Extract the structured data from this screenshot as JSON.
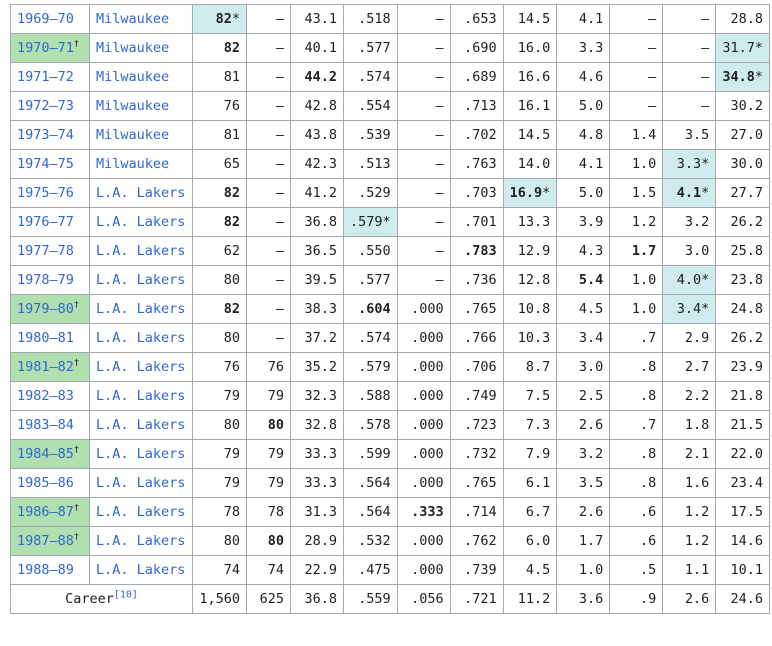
{
  "rows": [
    {
      "year": "1969–70",
      "champ": false,
      "team": "Milwaukee",
      "gp": {
        "v": "82",
        "mark": "*",
        "bold": true,
        "lead": true
      },
      "gs": {
        "v": "–"
      },
      "mpg": {
        "v": "43.1"
      },
      "fg": {
        "v": ".518"
      },
      "tp": {
        "v": "–"
      },
      "ft": {
        "v": ".653"
      },
      "rpg": {
        "v": "14.5"
      },
      "apg": {
        "v": "4.1"
      },
      "spg": {
        "v": "–"
      },
      "bpg": {
        "v": "–"
      },
      "ppg": {
        "v": "28.8"
      }
    },
    {
      "year": "1970–71",
      "champ": true,
      "team": "Milwaukee",
      "gp": {
        "v": "82",
        "bold": true
      },
      "gs": {
        "v": "–"
      },
      "mpg": {
        "v": "40.1"
      },
      "fg": {
        "v": ".577"
      },
      "tp": {
        "v": "–"
      },
      "ft": {
        "v": ".690"
      },
      "rpg": {
        "v": "16.0"
      },
      "apg": {
        "v": "3.3"
      },
      "spg": {
        "v": "–"
      },
      "bpg": {
        "v": "–"
      },
      "ppg": {
        "v": "31.7",
        "mark": "*",
        "lead": true
      }
    },
    {
      "year": "1971–72",
      "champ": false,
      "team": "Milwaukee",
      "gp": {
        "v": "81"
      },
      "gs": {
        "v": "–"
      },
      "mpg": {
        "v": "44.2",
        "bold": true
      },
      "fg": {
        "v": ".574"
      },
      "tp": {
        "v": "–"
      },
      "ft": {
        "v": ".689"
      },
      "rpg": {
        "v": "16.6"
      },
      "apg": {
        "v": "4.6"
      },
      "spg": {
        "v": "–"
      },
      "bpg": {
        "v": "–"
      },
      "ppg": {
        "v": "34.8",
        "mark": "*",
        "bold": true,
        "lead": true
      }
    },
    {
      "year": "1972–73",
      "champ": false,
      "team": "Milwaukee",
      "gp": {
        "v": "76"
      },
      "gs": {
        "v": "–"
      },
      "mpg": {
        "v": "42.8"
      },
      "fg": {
        "v": ".554"
      },
      "tp": {
        "v": "–"
      },
      "ft": {
        "v": ".713"
      },
      "rpg": {
        "v": "16.1"
      },
      "apg": {
        "v": "5.0"
      },
      "spg": {
        "v": "–"
      },
      "bpg": {
        "v": "–"
      },
      "ppg": {
        "v": "30.2"
      }
    },
    {
      "year": "1973–74",
      "champ": false,
      "team": "Milwaukee",
      "gp": {
        "v": "81"
      },
      "gs": {
        "v": "–"
      },
      "mpg": {
        "v": "43.8"
      },
      "fg": {
        "v": ".539"
      },
      "tp": {
        "v": "–"
      },
      "ft": {
        "v": ".702"
      },
      "rpg": {
        "v": "14.5"
      },
      "apg": {
        "v": "4.8"
      },
      "spg": {
        "v": "1.4"
      },
      "bpg": {
        "v": "3.5"
      },
      "ppg": {
        "v": "27.0"
      }
    },
    {
      "year": "1974–75",
      "champ": false,
      "team": "Milwaukee",
      "gp": {
        "v": "65"
      },
      "gs": {
        "v": "–"
      },
      "mpg": {
        "v": "42.3"
      },
      "fg": {
        "v": ".513"
      },
      "tp": {
        "v": "–"
      },
      "ft": {
        "v": ".763"
      },
      "rpg": {
        "v": "14.0"
      },
      "apg": {
        "v": "4.1"
      },
      "spg": {
        "v": "1.0"
      },
      "bpg": {
        "v": "3.3",
        "mark": "*",
        "lead": true
      },
      "ppg": {
        "v": "30.0"
      }
    },
    {
      "year": "1975–76",
      "champ": false,
      "team": "L.A. Lakers",
      "gp": {
        "v": "82",
        "bold": true
      },
      "gs": {
        "v": "–"
      },
      "mpg": {
        "v": "41.2"
      },
      "fg": {
        "v": ".529"
      },
      "tp": {
        "v": "–"
      },
      "ft": {
        "v": ".703"
      },
      "rpg": {
        "v": "16.9",
        "mark": "*",
        "bold": true,
        "lead": true
      },
      "apg": {
        "v": "5.0"
      },
      "spg": {
        "v": "1.5"
      },
      "bpg": {
        "v": "4.1",
        "mark": "*",
        "bold": true,
        "lead": true
      },
      "ppg": {
        "v": "27.7"
      }
    },
    {
      "year": "1976–77",
      "champ": false,
      "team": "L.A. Lakers",
      "gp": {
        "v": "82",
        "bold": true
      },
      "gs": {
        "v": "–"
      },
      "mpg": {
        "v": "36.8"
      },
      "fg": {
        "v": ".579",
        "mark": "*",
        "lead": true
      },
      "tp": {
        "v": "–"
      },
      "ft": {
        "v": ".701"
      },
      "rpg": {
        "v": "13.3"
      },
      "apg": {
        "v": "3.9"
      },
      "spg": {
        "v": "1.2"
      },
      "bpg": {
        "v": "3.2"
      },
      "ppg": {
        "v": "26.2"
      }
    },
    {
      "year": "1977–78",
      "champ": false,
      "team": "L.A. Lakers",
      "gp": {
        "v": "62"
      },
      "gs": {
        "v": "–"
      },
      "mpg": {
        "v": "36.5"
      },
      "fg": {
        "v": ".550"
      },
      "tp": {
        "v": "–"
      },
      "ft": {
        "v": ".783",
        "bold": true
      },
      "rpg": {
        "v": "12.9"
      },
      "apg": {
        "v": "4.3"
      },
      "spg": {
        "v": "1.7",
        "bold": true
      },
      "bpg": {
        "v": "3.0"
      },
      "ppg": {
        "v": "25.8"
      }
    },
    {
      "year": "1978–79",
      "champ": false,
      "team": "L.A. Lakers",
      "gp": {
        "v": "80"
      },
      "gs": {
        "v": "–"
      },
      "mpg": {
        "v": "39.5"
      },
      "fg": {
        "v": ".577"
      },
      "tp": {
        "v": "–"
      },
      "ft": {
        "v": ".736"
      },
      "rpg": {
        "v": "12.8"
      },
      "apg": {
        "v": "5.4",
        "bold": true
      },
      "spg": {
        "v": "1.0"
      },
      "bpg": {
        "v": "4.0",
        "mark": "*",
        "lead": true
      },
      "ppg": {
        "v": "23.8"
      }
    },
    {
      "year": "1979–80",
      "champ": true,
      "team": "L.A. Lakers",
      "gp": {
        "v": "82",
        "bold": true
      },
      "gs": {
        "v": "–"
      },
      "mpg": {
        "v": "38.3"
      },
      "fg": {
        "v": ".604",
        "bold": true
      },
      "tp": {
        "v": ".000"
      },
      "ft": {
        "v": ".765"
      },
      "rpg": {
        "v": "10.8"
      },
      "apg": {
        "v": "4.5"
      },
      "spg": {
        "v": "1.0"
      },
      "bpg": {
        "v": "3.4",
        "mark": "*",
        "lead": true
      },
      "ppg": {
        "v": "24.8"
      }
    },
    {
      "year": "1980–81",
      "champ": false,
      "team": "L.A. Lakers",
      "gp": {
        "v": "80"
      },
      "gs": {
        "v": "–"
      },
      "mpg": {
        "v": "37.2"
      },
      "fg": {
        "v": ".574"
      },
      "tp": {
        "v": ".000"
      },
      "ft": {
        "v": ".766"
      },
      "rpg": {
        "v": "10.3"
      },
      "apg": {
        "v": "3.4"
      },
      "spg": {
        "v": ".7"
      },
      "bpg": {
        "v": "2.9"
      },
      "ppg": {
        "v": "26.2"
      }
    },
    {
      "year": "1981–82",
      "champ": true,
      "team": "L.A. Lakers",
      "gp": {
        "v": "76"
      },
      "gs": {
        "v": "76"
      },
      "mpg": {
        "v": "35.2"
      },
      "fg": {
        "v": ".579"
      },
      "tp": {
        "v": ".000"
      },
      "ft": {
        "v": ".706"
      },
      "rpg": {
        "v": "8.7"
      },
      "apg": {
        "v": "3.0"
      },
      "spg": {
        "v": ".8"
      },
      "bpg": {
        "v": "2.7"
      },
      "ppg": {
        "v": "23.9"
      }
    },
    {
      "year": "1982–83",
      "champ": false,
      "team": "L.A. Lakers",
      "gp": {
        "v": "79"
      },
      "gs": {
        "v": "79"
      },
      "mpg": {
        "v": "32.3"
      },
      "fg": {
        "v": ".588"
      },
      "tp": {
        "v": ".000"
      },
      "ft": {
        "v": ".749"
      },
      "rpg": {
        "v": "7.5"
      },
      "apg": {
        "v": "2.5"
      },
      "spg": {
        "v": ".8"
      },
      "bpg": {
        "v": "2.2"
      },
      "ppg": {
        "v": "21.8"
      }
    },
    {
      "year": "1983–84",
      "champ": false,
      "team": "L.A. Lakers",
      "gp": {
        "v": "80"
      },
      "gs": {
        "v": "80",
        "bold": true
      },
      "mpg": {
        "v": "32.8"
      },
      "fg": {
        "v": ".578"
      },
      "tp": {
        "v": ".000"
      },
      "ft": {
        "v": ".723"
      },
      "rpg": {
        "v": "7.3"
      },
      "apg": {
        "v": "2.6"
      },
      "spg": {
        "v": ".7"
      },
      "bpg": {
        "v": "1.8"
      },
      "ppg": {
        "v": "21.5"
      }
    },
    {
      "year": "1984–85",
      "champ": true,
      "team": "L.A. Lakers",
      "gp": {
        "v": "79"
      },
      "gs": {
        "v": "79"
      },
      "mpg": {
        "v": "33.3"
      },
      "fg": {
        "v": ".599"
      },
      "tp": {
        "v": ".000"
      },
      "ft": {
        "v": ".732"
      },
      "rpg": {
        "v": "7.9"
      },
      "apg": {
        "v": "3.2"
      },
      "spg": {
        "v": ".8"
      },
      "bpg": {
        "v": "2.1"
      },
      "ppg": {
        "v": "22.0"
      }
    },
    {
      "year": "1985–86",
      "champ": false,
      "team": "L.A. Lakers",
      "gp": {
        "v": "79"
      },
      "gs": {
        "v": "79"
      },
      "mpg": {
        "v": "33.3"
      },
      "fg": {
        "v": ".564"
      },
      "tp": {
        "v": ".000"
      },
      "ft": {
        "v": ".765"
      },
      "rpg": {
        "v": "6.1"
      },
      "apg": {
        "v": "3.5"
      },
      "spg": {
        "v": ".8"
      },
      "bpg": {
        "v": "1.6"
      },
      "ppg": {
        "v": "23.4"
      }
    },
    {
      "year": "1986–87",
      "champ": true,
      "team": "L.A. Lakers",
      "gp": {
        "v": "78"
      },
      "gs": {
        "v": "78"
      },
      "mpg": {
        "v": "31.3"
      },
      "fg": {
        "v": ".564"
      },
      "tp": {
        "v": ".333",
        "bold": true
      },
      "ft": {
        "v": ".714"
      },
      "rpg": {
        "v": "6.7"
      },
      "apg": {
        "v": "2.6"
      },
      "spg": {
        "v": ".6"
      },
      "bpg": {
        "v": "1.2"
      },
      "ppg": {
        "v": "17.5"
      }
    },
    {
      "year": "1987–88",
      "champ": true,
      "team": "L.A. Lakers",
      "gp": {
        "v": "80"
      },
      "gs": {
        "v": "80",
        "bold": true
      },
      "mpg": {
        "v": "28.9"
      },
      "fg": {
        "v": ".532"
      },
      "tp": {
        "v": ".000"
      },
      "ft": {
        "v": ".762"
      },
      "rpg": {
        "v": "6.0"
      },
      "apg": {
        "v": "1.7"
      },
      "spg": {
        "v": ".6"
      },
      "bpg": {
        "v": "1.2"
      },
      "ppg": {
        "v": "14.6"
      }
    },
    {
      "year": "1988–89",
      "champ": false,
      "team": "L.A. Lakers",
      "gp": {
        "v": "74"
      },
      "gs": {
        "v": "74"
      },
      "mpg": {
        "v": "22.9"
      },
      "fg": {
        "v": ".475"
      },
      "tp": {
        "v": ".000"
      },
      "ft": {
        "v": ".739"
      },
      "rpg": {
        "v": "4.5"
      },
      "apg": {
        "v": "1.0"
      },
      "spg": {
        "v": ".5"
      },
      "bpg": {
        "v": "1.1"
      },
      "ppg": {
        "v": "10.1"
      }
    }
  ],
  "champ_mark": "†",
  "career": {
    "label": "Career",
    "ref": "[10]",
    "gp": "1,560",
    "gs": "625",
    "mpg": "36.8",
    "fg": ".559",
    "tp": ".056",
    "ft": ".721",
    "rpg": "11.2",
    "apg": "3.6",
    "spg": ".9",
    "bpg": "2.6",
    "ppg": "24.6"
  },
  "colors": {
    "champion_bg": "#b0e0b0",
    "league_leader_bg": "#cfecec",
    "link": "#3366cc",
    "border": "#a2a9b1"
  }
}
